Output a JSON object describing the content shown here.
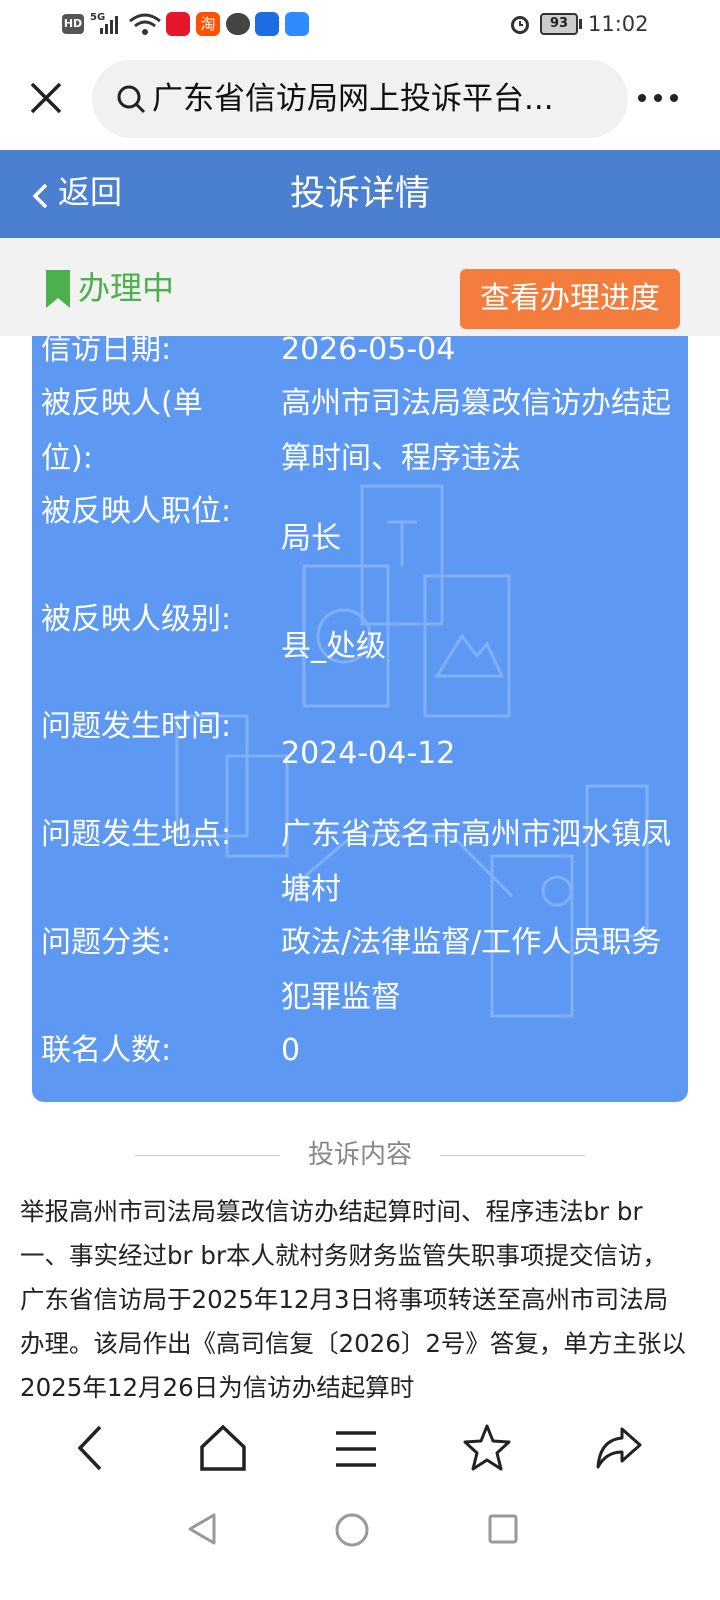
{
  "status_bar": {
    "hd": "HD",
    "network": "5G",
    "battery": "93",
    "time": "11:02"
  },
  "browser": {
    "url_title": "广东省信访局网上投诉平台...",
    "icons": [
      "close-icon",
      "search-icon",
      "more-icon"
    ]
  },
  "header": {
    "back_label": "返回",
    "title": "投诉详情"
  },
  "status": {
    "label": "办理中",
    "button": "查看办理进度",
    "colors": {
      "status": "#4cb04c",
      "button": "#f47c3c",
      "header": "#4b80d0",
      "card": "#5d99f3"
    }
  },
  "details": [
    {
      "label": "信访日期:",
      "value": "2026-05-04"
    },
    {
      "label": "被反映人(单位):",
      "value": "高州市司法局篡改信访办结起算时间、程序违法"
    },
    {
      "label": "被反映人职位:",
      "value": "局长"
    },
    {
      "label": "被反映人级别:",
      "value": "县_处级"
    },
    {
      "label": "问题发生时间:",
      "value": "2024-04-12"
    },
    {
      "label": "问题发生地点:",
      "value": "广东省茂名市高州市泗水镇凤塘村"
    },
    {
      "label": "问题分类:",
      "value": "政法/法律监督/工作人员职务犯罪监督"
    },
    {
      "label": "联名人数:",
      "value": "0"
    }
  ],
  "section": {
    "title": "投诉内容"
  },
  "content": {
    "text": "举报高州市司法局篡改信访办结起算时间、程序违法br br一、事实经过br br本人就村务财务监管失职事项提交信访，广东省信访局于2025年12月3日将事项转送至高州市司法局办理。该局作出《高司信复〔2026〕2号》答复，单方主张以2025年12月26日为信访办结起算时"
  },
  "bottom_nav": {
    "icons": [
      "back-icon",
      "home-icon",
      "menu-icon",
      "star-icon",
      "share-icon"
    ]
  },
  "system_nav": {
    "icons": [
      "sys-back-icon",
      "sys-home-icon",
      "sys-recent-icon"
    ]
  }
}
